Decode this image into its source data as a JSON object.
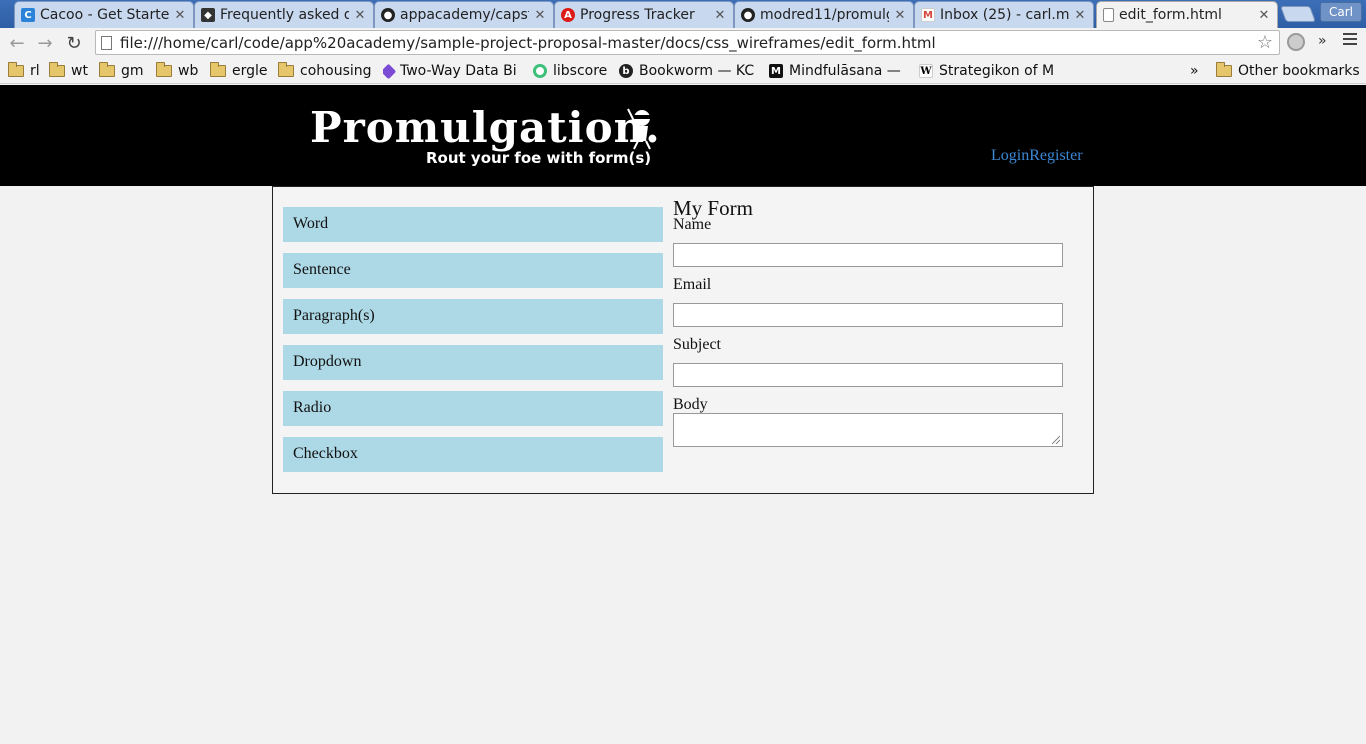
{
  "browser": {
    "tabs": [
      {
        "title": "Cacoo - Get Started",
        "icon": "cacoo-icon",
        "color": "#2b83d9"
      },
      {
        "title": "Frequently asked questions",
        "icon": "ninja-icon",
        "color": "#333333"
      },
      {
        "title": "appacademy/capstone",
        "icon": "github-icon",
        "color": "#222222"
      },
      {
        "title": "Progress Tracker",
        "icon": "angular-icon",
        "color": "#dd1b16"
      },
      {
        "title": "modred11/promulgation",
        "icon": "github-icon",
        "color": "#222222"
      },
      {
        "title": "Inbox (25) - carl.ma",
        "icon": "gmail-icon",
        "color": "#d44638"
      },
      {
        "title": "edit_form.html",
        "icon": "page-icon",
        "color": "#777777"
      }
    ],
    "profile_label": "Carl",
    "url": "file:///home/carl/code/app%20academy/sample-project-proposal-master/docs/css_wireframes/edit_form.html",
    "bookmarks": [
      {
        "label": "rl",
        "type": "folder"
      },
      {
        "label": "wt",
        "type": "folder"
      },
      {
        "label": "gm",
        "type": "folder"
      },
      {
        "label": "wb",
        "type": "folder"
      },
      {
        "label": "ergle",
        "type": "folder"
      },
      {
        "label": "cohousing",
        "type": "folder"
      },
      {
        "label": "Two-Way Data Bi",
        "type": "link",
        "color": "#7b4bd6"
      },
      {
        "label": "libscore",
        "type": "link",
        "color": "#3cc07a"
      },
      {
        "label": "Bookworm — KC",
        "type": "link",
        "color": "#222222"
      },
      {
        "label": "Mindfulāsana —",
        "type": "link",
        "color": "#111111"
      },
      {
        "label": "Strategikon of M",
        "type": "link",
        "color": "#ffffff"
      }
    ],
    "bookmarks_overflow": "»",
    "other_bookmarks": "Other bookmarks",
    "extensions_overflow": "»"
  },
  "site": {
    "logo_text": "Promulgation.",
    "tagline": "Rout your foe with form(s)",
    "login": "Login",
    "register": "Register"
  },
  "field_types": [
    "Word",
    "Sentence",
    "Paragraph(s)",
    "Dropdown",
    "Radio",
    "Checkbox"
  ],
  "form": {
    "title": "My Form",
    "fields": [
      {
        "label": "Name",
        "value": ""
      },
      {
        "label": "Email",
        "value": ""
      },
      {
        "label": "Subject",
        "value": ""
      },
      {
        "label": "Body",
        "value": ""
      }
    ]
  },
  "colors": {
    "header_bg": "#000000",
    "field_type_bg": "#add8e6",
    "link": "#3b88d6",
    "page_bg": "#f2f2f2"
  }
}
